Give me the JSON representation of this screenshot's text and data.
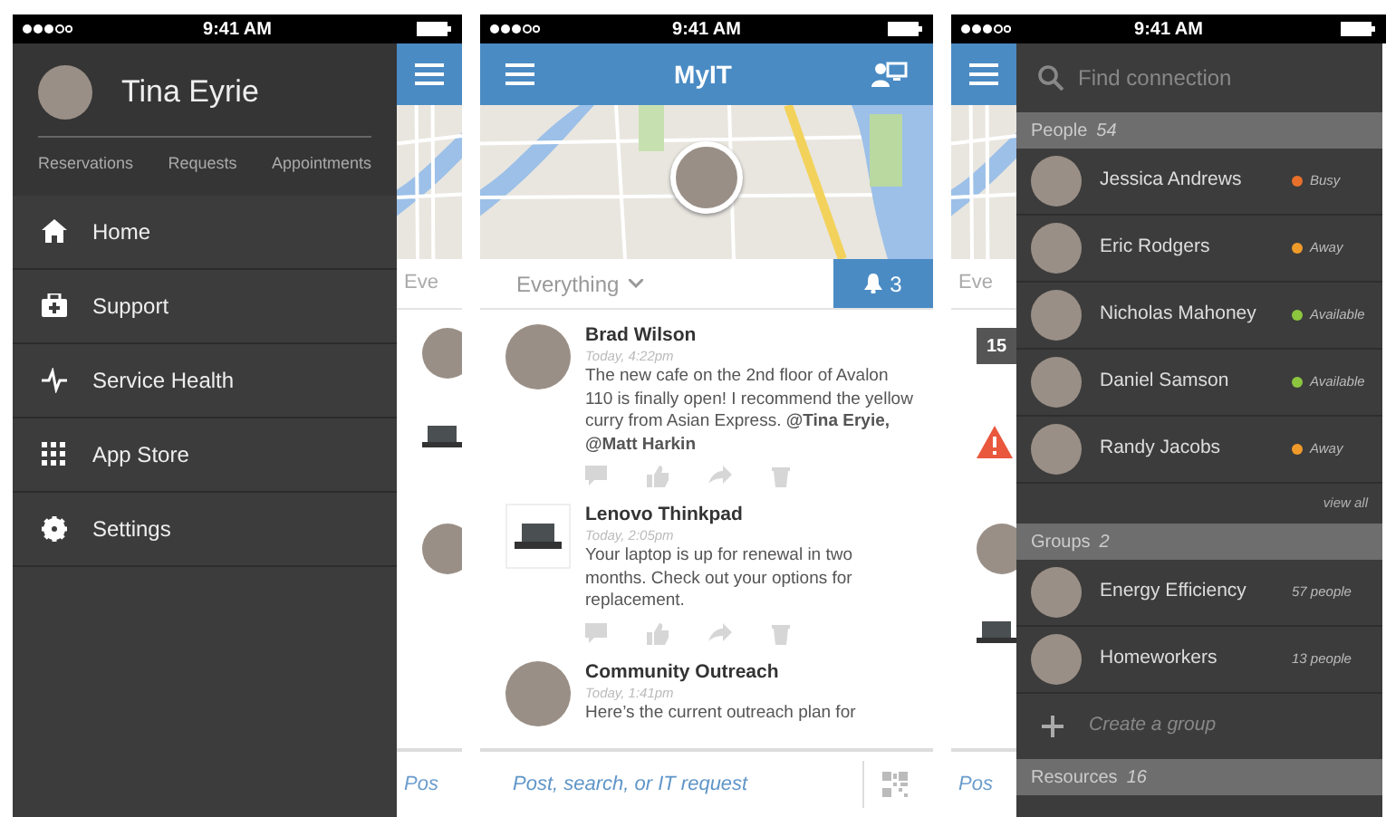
{
  "screens": [
    {
      "kind": "menu",
      "status": {
        "time": "9:41 AM"
      },
      "peek": {
        "filter": "Eve",
        "items": [
          {
            "kind": "avatar"
          },
          {
            "kind": "device"
          },
          {
            "kind": "avatar"
          }
        ],
        "footer": "Pos"
      },
      "drawer": {
        "user": "Tina Eyrie",
        "links": [
          "Reservations",
          "Requests",
          "Appointments"
        ],
        "menu": [
          "Home",
          "Support",
          "Service Health",
          "App Store",
          "Settings"
        ]
      }
    },
    {
      "kind": "feed",
      "status": {
        "time": "9:41 AM"
      },
      "title": "MyIT",
      "filter": "Everything",
      "alerts": "3",
      "posts": [
        {
          "author": "Brad Wilson",
          "time": "Today, 4:22pm",
          "text": "The new cafe on the 2nd floor of Avalon 110 is finally open!  I recommend the yellow curry from Asian Express. **@Tina Eryie, @Matt Harkin**",
          "kind": "avatar",
          "actions": true
        },
        {
          "author": "Lenovo Thinkpad",
          "time": "Today, 2:05pm",
          "text": "Your laptop is up for renewal in two months. Check out your options for replacement.",
          "kind": "device",
          "actions": true
        },
        {
          "author": "Community Outreach",
          "time": "Today, 1:41pm",
          "text": "Here’s the current outreach plan for",
          "kind": "avatar",
          "actions": false
        }
      ],
      "composer": {
        "placeholder": "Post, search, or IT request"
      }
    },
    {
      "kind": "connections",
      "status": {
        "time": "9:41 AM"
      },
      "peek": {
        "filter": "Eve",
        "items": [
          {
            "kind": "calendar",
            "text": "15"
          },
          {
            "kind": "alert"
          },
          {
            "kind": "avatar"
          },
          {
            "kind": "device"
          }
        ],
        "footer": "Pos"
      },
      "panel": {
        "search": {
          "placeholder": "Find connection"
        },
        "sections": [
          {
            "title": "People",
            "count": "54",
            "items": [
              {
                "name": "Jessica Andrews",
                "status": "Busy",
                "color": "#e8702a"
              },
              {
                "name": "Eric Rodgers",
                "status": "Away",
                "color": "#f09a2a"
              },
              {
                "name": "Nicholas Mahoney",
                "status": "Available",
                "color": "#8cc63f"
              },
              {
                "name": "Daniel Samson",
                "status": "Available",
                "color": "#8cc63f"
              },
              {
                "name": "Randy Jacobs",
                "status": "Away",
                "color": "#f09a2a"
              }
            ],
            "more": "view all"
          },
          {
            "title": "Groups",
            "count": "2",
            "items": [
              {
                "name": "Energy Efficiency",
                "status": "57 people"
              },
              {
                "name": "Homeworkers",
                "status": "13 people"
              }
            ],
            "create": "Create a group"
          },
          {
            "title": "Resources",
            "count": "16"
          }
        ]
      }
    }
  ]
}
